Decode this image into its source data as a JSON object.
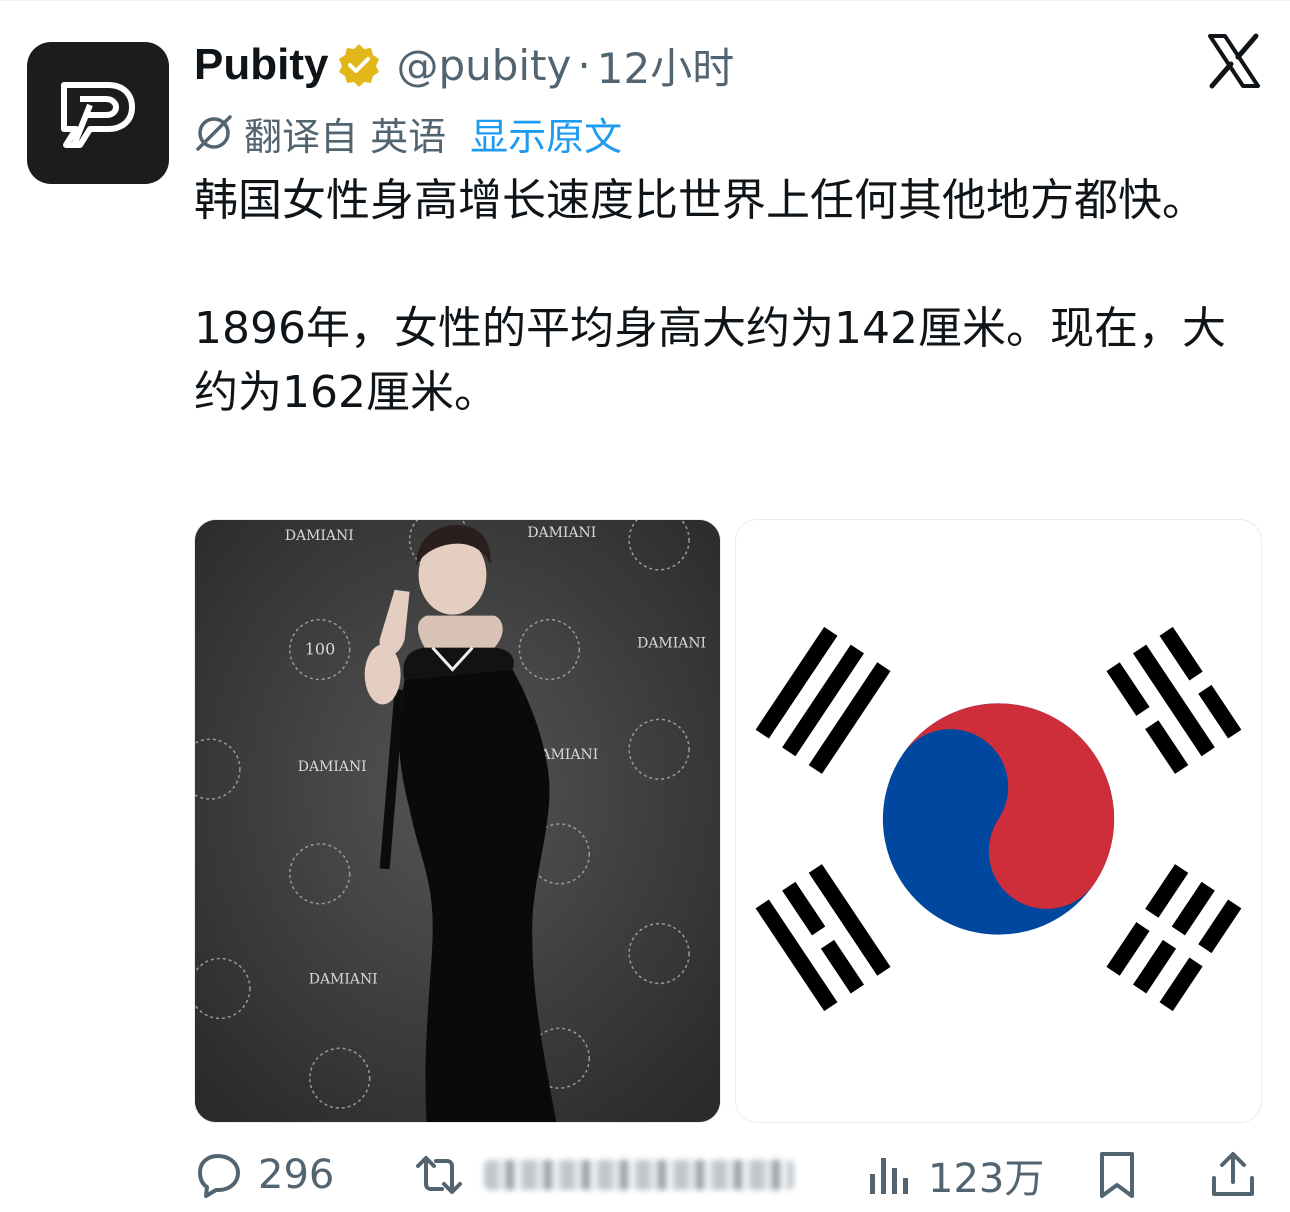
{
  "author": {
    "display_name": "Pubity",
    "handle": "@pubity",
    "separator": "·",
    "time": "12小时"
  },
  "translation": {
    "translated_from": "翻译自 英语",
    "show_original": "显示原文"
  },
  "tweet": {
    "paragraph_1": "韩国女性身高增长速度比世界上任何其他地方都快。",
    "paragraph_2": "1896年，女性的平均身高大约为142厘米。现在，大约为162厘米。"
  },
  "media": {
    "photo_backdrop_text": [
      "DAMIANI",
      "100",
      "DAMIANI",
      "DAMIANI",
      "DAMIANI",
      "DAMIANI",
      "DAMIANI"
    ]
  },
  "actions": {
    "replies": "296",
    "views": "123万"
  },
  "icons": {
    "avatar": "pubity-logo-icon",
    "verified": "verified-badge-icon",
    "platform": "x-logo-icon",
    "translate": "translate-icon",
    "reply": "reply-icon",
    "repost": "repost-icon",
    "views": "views-icon",
    "bookmark": "bookmark-icon",
    "share": "share-icon"
  },
  "colors": {
    "link": "#1d9bf0",
    "secondary_text": "#536471",
    "verified_gold": "#e2b719",
    "flag_red": "#cd2e3a",
    "flag_blue": "#0047a0"
  }
}
